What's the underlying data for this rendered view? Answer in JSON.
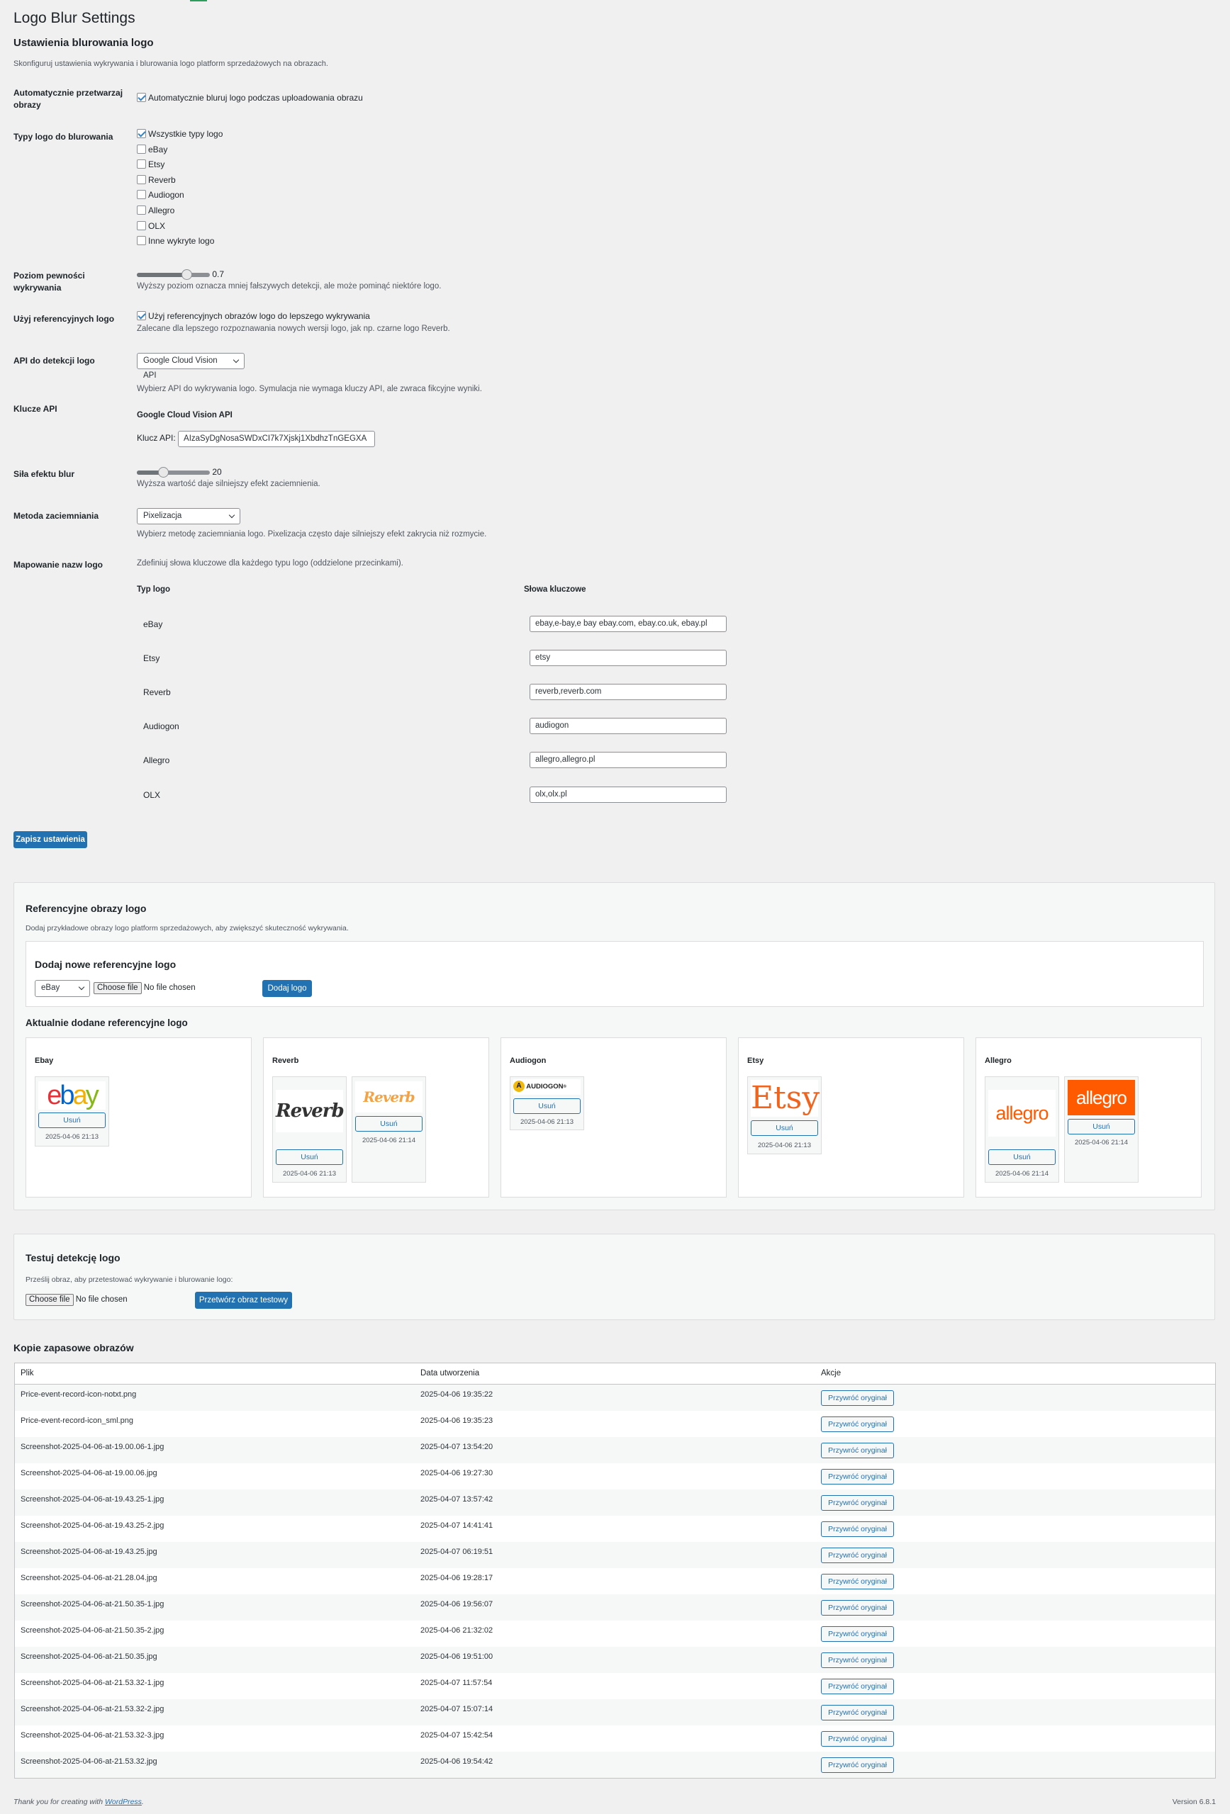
{
  "page": {
    "title": "Logo Blur Settings",
    "section_title": "Ustawienia blurowania logo",
    "section_desc": "Skonfiguruj ustawienia wykrywania i blurowania logo platform sprzedażowych na obrazach."
  },
  "auto": {
    "label": "Automatycznie przetwarzaj obrazy",
    "checkbox_label": "Automatycznie bluruj logo podczas uploadowania obrazu",
    "checked": true
  },
  "types": {
    "label": "Typy logo do blurowania",
    "items": [
      {
        "label": "Wszystkie typy logo",
        "checked": true
      },
      {
        "label": "eBay",
        "checked": false
      },
      {
        "label": "Etsy",
        "checked": false
      },
      {
        "label": "Reverb",
        "checked": false
      },
      {
        "label": "Audiogon",
        "checked": false
      },
      {
        "label": "Allegro",
        "checked": false
      },
      {
        "label": "OLX",
        "checked": false
      },
      {
        "label": "Inne wykryte logo",
        "checked": false
      }
    ]
  },
  "confidence": {
    "label": "Poziom pewności wykrywania",
    "value": "0.7",
    "fraction": 0.7,
    "desc": "Wyższy poziom oznacza mniej fałszywych detekcji, ale może pominąć niektóre logo."
  },
  "reference": {
    "label": "Użyj referencyjnych logo",
    "checkbox_label": "Użyj referencyjnych obrazów logo do lepszego wykrywania",
    "desc": "Zalecane dla lepszego rozpoznawania nowych wersji logo, jak np. czarne logo Reverb.",
    "checked": true
  },
  "api": {
    "label": "API do detekcji logo",
    "selected": "Google Cloud Vision API",
    "desc": "Wybierz API do wykrywania logo. Symulacja nie wymaga kluczy API, ale zwraca fikcyjne wyniki."
  },
  "keys": {
    "label": "Klucze API",
    "heading": "Google Cloud Vision API",
    "key_label": "Klucz API:",
    "key_value": "AIzaSyDgNosaSWDxCI7k7Xjskj1XbdhzTnGEGXA"
  },
  "blur": {
    "label": "Siła efektu blur",
    "value": "20",
    "fraction": 0.36,
    "desc": "Wyższa wartość daje silniejszy efekt zaciemnienia."
  },
  "method": {
    "label": "Metoda zaciemniania",
    "selected": "Pixelizacja",
    "desc": "Wybierz metodę zaciemniania logo. Pixelizacja często daje silniejszy efekt zakrycia niż rozmycie."
  },
  "mapping": {
    "label": "Mapowanie nazw logo",
    "desc": "Zdefiniuj słowa kluczowe dla każdego typu logo (oddzielone przecinkami).",
    "col_type": "Typ logo",
    "col_keywords": "Słowa kluczowe",
    "rows": [
      {
        "type": "eBay",
        "keywords": "ebay,e-bay,e bay ebay.com, ebay.co.uk, ebay.pl"
      },
      {
        "type": "Etsy",
        "keywords": "etsy"
      },
      {
        "type": "Reverb",
        "keywords": "reverb,reverb.com"
      },
      {
        "type": "Audiogon",
        "keywords": "audiogon"
      },
      {
        "type": "Allegro",
        "keywords": "allegro,allegro.pl"
      },
      {
        "type": "OLX",
        "keywords": "olx,olx.pl"
      }
    ]
  },
  "save_button": "Zapisz ustawienia",
  "ref_panel": {
    "title": "Referencyjne obrazy logo",
    "desc": "Dodaj przykładowe obrazy logo platform sprzedażowych, aby zwiększyć skuteczność wykrywania.",
    "add_title": "Dodaj nowe referencyjne logo",
    "add_select": "eBay",
    "choose_file": "Choose file",
    "no_file": "No file chosen",
    "add_button": "Dodaj logo",
    "current_title": "Aktualnie dodane referencyjne logo",
    "remove_label": "Usuń",
    "cards": [
      {
        "title": "Ebay",
        "logos": [
          {
            "logo_text": "ebay",
            "date": "2025-04-06 21:13"
          }
        ]
      },
      {
        "title": "Reverb",
        "logos": [
          {
            "logo_text": "Reverb",
            "date": "2025-04-06 21:13"
          },
          {
            "logo_text": "Reverb",
            "date": "2025-04-06 21:14"
          }
        ]
      },
      {
        "title": "Audiogon",
        "logos": [
          {
            "logo_text": "AUDIOGON",
            "date": "2025-04-06 21:13"
          }
        ]
      },
      {
        "title": "Etsy",
        "logos": [
          {
            "logo_text": "Etsy",
            "date": "2025-04-06 21:13"
          }
        ]
      },
      {
        "title": "Allegro",
        "logos": [
          {
            "logo_text": "allegro",
            "date": "2025-04-06 21:14"
          },
          {
            "logo_text": "allegro",
            "date": "2025-04-06 21:14"
          }
        ]
      }
    ]
  },
  "test_panel": {
    "title": "Testuj detekcję logo",
    "desc": "Prześlij obraz, aby przetestować wykrywanie i blurowanie logo:",
    "choose_file": "Choose file",
    "no_file": "No file chosen",
    "button": "Przetwórz obraz testowy"
  },
  "backups": {
    "title": "Kopie zapasowe obrazów",
    "col_file": "Plik",
    "col_date": "Data utworzenia",
    "col_actions": "Akcje",
    "restore_label": "Przywróć oryginał",
    "rows": [
      {
        "file": "Price-event-record-icon-notxt.png",
        "date": "2025-04-06 19:35:22"
      },
      {
        "file": "Price-event-record-icon_sml.png",
        "date": "2025-04-06 19:35:23"
      },
      {
        "file": "Screenshot-2025-04-06-at-19.00.06-1.jpg",
        "date": "2025-04-07 13:54:20"
      },
      {
        "file": "Screenshot-2025-04-06-at-19.00.06.jpg",
        "date": "2025-04-06 19:27:30"
      },
      {
        "file": "Screenshot-2025-04-06-at-19.43.25-1.jpg",
        "date": "2025-04-07 13:57:42"
      },
      {
        "file": "Screenshot-2025-04-06-at-19.43.25-2.jpg",
        "date": "2025-04-07 14:41:41"
      },
      {
        "file": "Screenshot-2025-04-06-at-19.43.25.jpg",
        "date": "2025-04-07 06:19:51"
      },
      {
        "file": "Screenshot-2025-04-06-at-21.28.04.jpg",
        "date": "2025-04-06 19:28:17"
      },
      {
        "file": "Screenshot-2025-04-06-at-21.50.35-1.jpg",
        "date": "2025-04-06 19:56:07"
      },
      {
        "file": "Screenshot-2025-04-06-at-21.50.35-2.jpg",
        "date": "2025-04-06 21:32:02"
      },
      {
        "file": "Screenshot-2025-04-06-at-21.50.35.jpg",
        "date": "2025-04-06 19:51:00"
      },
      {
        "file": "Screenshot-2025-04-06-at-21.53.32-1.jpg",
        "date": "2025-04-07 11:57:54"
      },
      {
        "file": "Screenshot-2025-04-06-at-21.53.32-2.jpg",
        "date": "2025-04-07 15:07:14"
      },
      {
        "file": "Screenshot-2025-04-06-at-21.53.32-3.jpg",
        "date": "2025-04-07 15:42:54"
      },
      {
        "file": "Screenshot-2025-04-06-at-21.53.32.jpg",
        "date": "2025-04-06 19:54:42"
      }
    ]
  },
  "footer": {
    "thanks_prefix": "Thank you for creating with ",
    "wordpress_link": "WordPress",
    "thanks_suffix": ".",
    "version": "Version 6.8.1"
  },
  "colors": {
    "primary": "#2271b1",
    "background": "#f0f0f1",
    "ebay_red": "#e53238",
    "ebay_blue": "#0064d2",
    "ebay_yellow": "#f5af02",
    "ebay_green": "#86b817",
    "etsy_orange": "#f1641e",
    "allegro_orange": "#ff5a00"
  }
}
